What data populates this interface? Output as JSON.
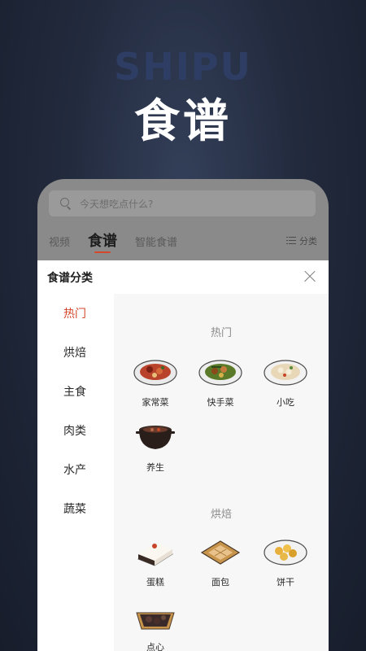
{
  "hero": {
    "bg_text": "SHIPU",
    "title": "食谱"
  },
  "search": {
    "placeholder": "今天想吃点什么?"
  },
  "tabs": [
    {
      "label": "视频"
    },
    {
      "label": "食谱"
    },
    {
      "label": "智能食谱"
    }
  ],
  "classify": {
    "label": "分类"
  },
  "sheet": {
    "title": "食谱分类",
    "sidebar": [
      "热门",
      "烘焙",
      "主食",
      "肉类",
      "水产",
      "蔬菜"
    ],
    "sections": [
      {
        "title": "热门",
        "items": [
          "家常菜",
          "快手菜",
          "小吃",
          "养生"
        ]
      },
      {
        "title": "烘焙",
        "items": [
          "蛋糕",
          "面包",
          "饼干",
          "点心"
        ]
      }
    ]
  },
  "colors": {
    "accent": "#d4472b"
  }
}
